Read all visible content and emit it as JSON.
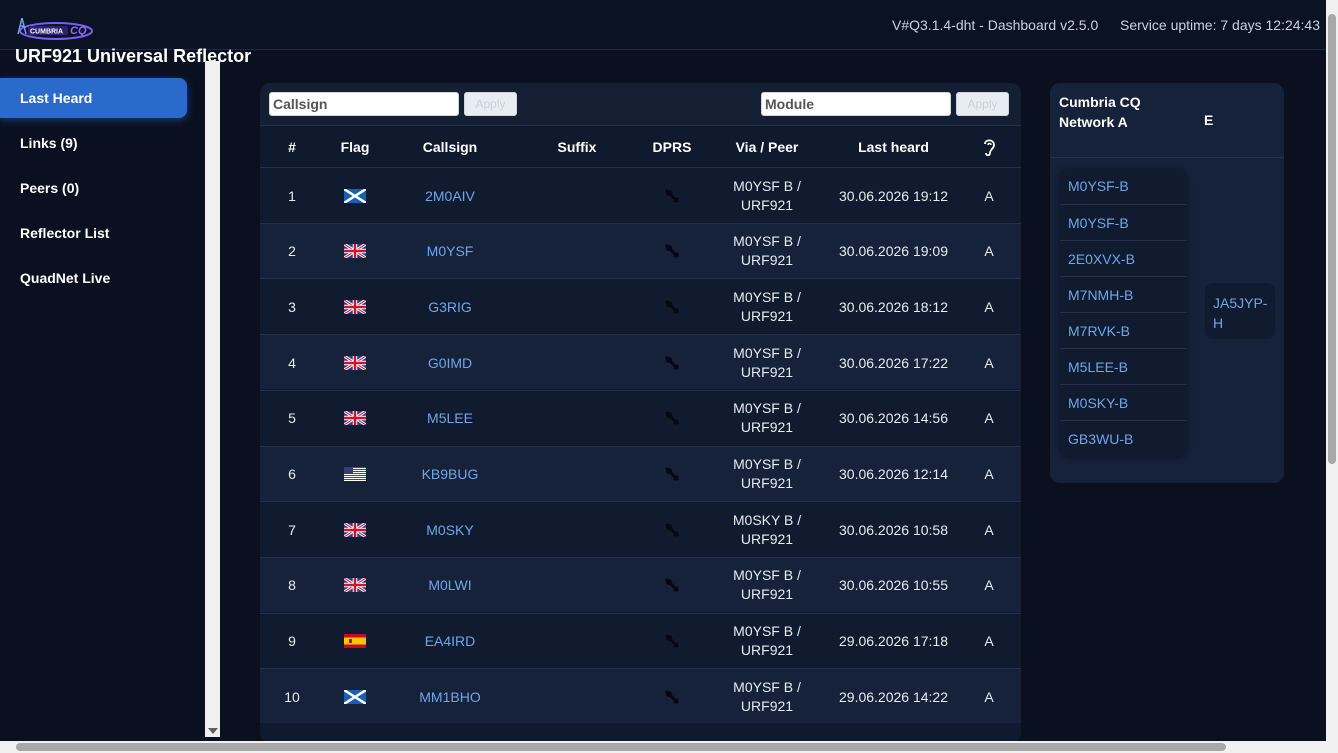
{
  "header": {
    "version": "V#Q3.1.4-dht - Dashboard v2.5.0",
    "uptime": "Service uptime: 7 days 12:24:43",
    "title": "URF921 Universal Reflector",
    "logo_text": "CUMBRIA CQ"
  },
  "sidebar": {
    "items": [
      {
        "label": "Last Heard",
        "active": true
      },
      {
        "label": "Links (9)"
      },
      {
        "label": "Peers (0)"
      },
      {
        "label": "Reflector List"
      },
      {
        "label": "QuadNet Live"
      }
    ]
  },
  "filters": {
    "callsign_placeholder": "Callsign",
    "module_placeholder": "Module",
    "apply_label": "Apply"
  },
  "table": {
    "columns": [
      "#",
      "Flag",
      "Callsign",
      "Suffix",
      "DPRS",
      "Via / Peer",
      "Last heard",
      "ear-icon"
    ],
    "rows": [
      {
        "n": "1",
        "flag": "scotland",
        "callsign": "2M0AIV",
        "suffix": "",
        "via": "M0YSF B /",
        "peer": "URF921",
        "heard": "30.06.2026 19:12",
        "module": "A"
      },
      {
        "n": "2",
        "flag": "uk",
        "callsign": "M0YSF",
        "suffix": "",
        "via": "M0YSF B /",
        "peer": "URF921",
        "heard": "30.06.2026 19:09",
        "module": "A"
      },
      {
        "n": "3",
        "flag": "uk",
        "callsign": "G3RIG",
        "suffix": "",
        "via": "M0YSF B /",
        "peer": "URF921",
        "heard": "30.06.2026 18:12",
        "module": "A"
      },
      {
        "n": "4",
        "flag": "uk",
        "callsign": "G0IMD",
        "suffix": "",
        "via": "M0YSF B /",
        "peer": "URF921",
        "heard": "30.06.2026 17:22",
        "module": "A"
      },
      {
        "n": "5",
        "flag": "uk",
        "callsign": "M5LEE",
        "suffix": "",
        "via": "M0YSF B /",
        "peer": "URF921",
        "heard": "30.06.2026 14:56",
        "module": "A"
      },
      {
        "n": "6",
        "flag": "us",
        "callsign": "KB9BUG",
        "suffix": "",
        "via": "M0YSF B /",
        "peer": "URF921",
        "heard": "30.06.2026 12:14",
        "module": "A"
      },
      {
        "n": "7",
        "flag": "uk",
        "callsign": "M0SKY",
        "suffix": "",
        "via": "M0SKY B /",
        "peer": "URF921",
        "heard": "30.06.2026 10:58",
        "module": "A"
      },
      {
        "n": "8",
        "flag": "uk",
        "callsign": "M0LWI",
        "suffix": "",
        "via": "M0YSF B /",
        "peer": "URF921",
        "heard": "30.06.2026 10:55",
        "module": "A"
      },
      {
        "n": "9",
        "flag": "spain",
        "callsign": "EA4IRD",
        "suffix": "",
        "via": "M0YSF B /",
        "peer": "URF921",
        "heard": "29.06.2026 17:18",
        "module": "A"
      },
      {
        "n": "10",
        "flag": "scotland",
        "callsign": "MM1BHO",
        "suffix": "",
        "via": "M0YSF B /",
        "peer": "URF921",
        "heard": "29.06.2026 14:22",
        "module": "A"
      }
    ]
  },
  "modules": {
    "a_title": "Cumbria CQ Network A",
    "e_title": "E",
    "a_links": [
      "M0YSF-B",
      "M0YSF-B",
      "2E0XVX-B",
      "M7NMH-B",
      "M7RVK-B",
      "M5LEE-B",
      "M0SKY-B",
      "GB3WU-B"
    ],
    "e_links": [
      "JA5JYP-H"
    ]
  },
  "colors": {
    "background": "#0a1020",
    "accent": "#2a6acb",
    "link": "#6fa6e8"
  }
}
